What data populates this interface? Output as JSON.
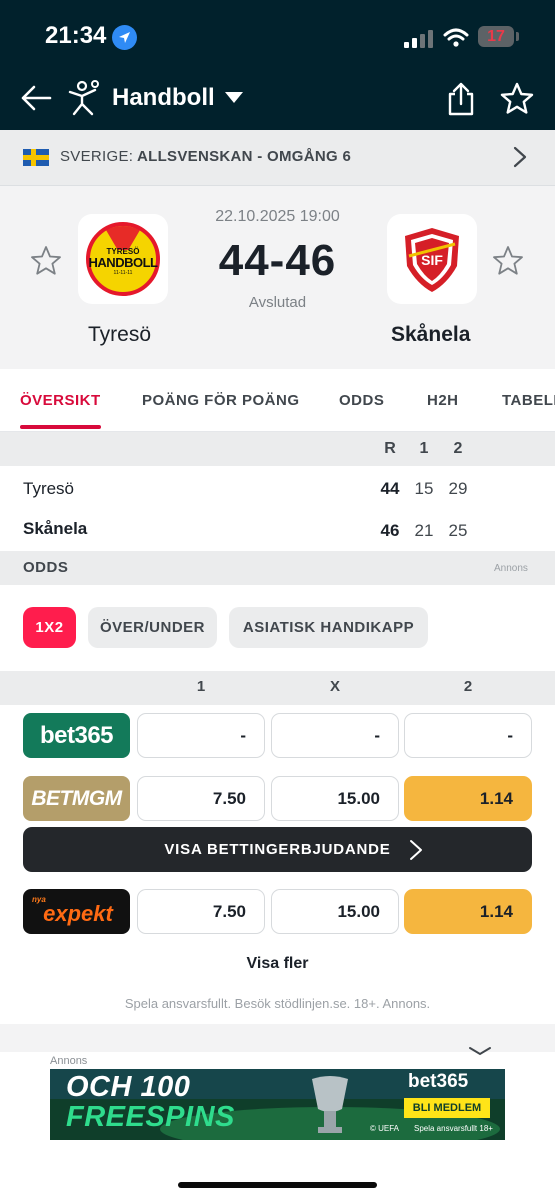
{
  "status": {
    "time": "21:34",
    "battery": "17"
  },
  "header": {
    "sport": "Handboll"
  },
  "league": {
    "country": "SVERIGE:",
    "name": "ALLSVENSKAN - OMGÅNG 6"
  },
  "match": {
    "date": "22.10.2025 19:00",
    "score": "44-46",
    "state": "Avslutad",
    "home": {
      "name": "Tyresö",
      "logo_top": "TYRESÖ",
      "logo_main": "HANDBOLL",
      "logo_sub": "11-11-11"
    },
    "away": {
      "name": "Skånela",
      "logo_text": "SIF"
    }
  },
  "tabs": [
    {
      "label": "ÖVERSIKT",
      "active": true
    },
    {
      "label": "POÄNG FÖR POÄNG"
    },
    {
      "label": "ODDS"
    },
    {
      "label": "H2H"
    },
    {
      "label": "TABELL"
    }
  ],
  "scoreboard": {
    "columns": [
      "R",
      "1",
      "2"
    ],
    "rows": [
      {
        "team": "Tyresö",
        "r": "44",
        "p1": "15",
        "p2": "29",
        "winner": false
      },
      {
        "team": "Skånela",
        "r": "46",
        "p1": "21",
        "p2": "25",
        "winner": true
      }
    ]
  },
  "odds": {
    "title": "ODDS",
    "ad_label": "Annons",
    "markets": [
      "1X2",
      "ÖVER/UNDER",
      "ASIATISK HANDIKAPP"
    ],
    "columns": [
      "1",
      "X",
      "2"
    ],
    "bookmakers": [
      {
        "name": "bet365",
        "values": [
          "-",
          "-",
          "-"
        ],
        "color": "#137a5a"
      },
      {
        "name": "BETMGM",
        "values": [
          "7.50",
          "15.00",
          "1.14"
        ],
        "color": "#b49e6a"
      },
      {
        "name": "expekt",
        "prefix": "nya",
        "values": [
          "7.50",
          "15.00",
          "1.14"
        ],
        "color": "#111111"
      }
    ],
    "promo_label": "VISA BETTINGERBJUDANDE",
    "more_label": "Visa fler",
    "disclaimer": "Spela ansvarsfullt. Besök stödlinjen.se. 18+. Annons."
  },
  "ad": {
    "label": "Annons",
    "line1": "OCH 100",
    "line2": "FREESPINS",
    "brand": "bet365",
    "cta": "BLI MEDLEM",
    "footer_left": "© UEFA",
    "footer_right": "Spela ansvarsfullt 18+"
  },
  "colors": {
    "accent": "#d80a3b",
    "header_bg": "#01212c",
    "highlight": "#f5b63f"
  }
}
